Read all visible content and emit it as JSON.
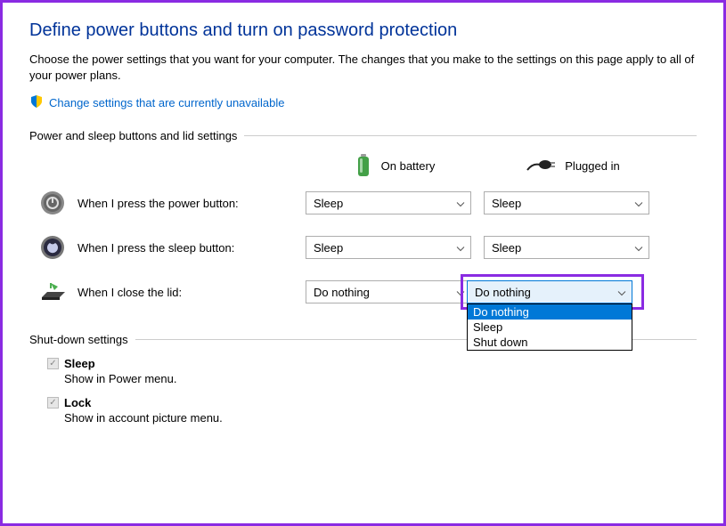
{
  "title": "Define power buttons and turn on password protection",
  "description": "Choose the power settings that you want for your computer. The changes that you make to the settings on this page apply to all of your power plans.",
  "change_link": "Change settings that are currently unavailable",
  "section1_header": "Power and sleep buttons and lid settings",
  "columns": {
    "battery": "On battery",
    "plugged": "Plugged in"
  },
  "rows": {
    "power": {
      "label": "When I press the power button:",
      "battery_value": "Sleep",
      "plugged_value": "Sleep"
    },
    "sleep": {
      "label": "When I press the sleep button:",
      "battery_value": "Sleep",
      "plugged_value": "Sleep"
    },
    "lid": {
      "label": "When I close the lid:",
      "battery_value": "Do nothing",
      "plugged_value": "Do nothing"
    }
  },
  "dropdown": {
    "options": [
      "Do nothing",
      "Sleep",
      "Shut down"
    ],
    "selected": "Do nothing"
  },
  "section2_header": "Shut-down settings",
  "shutdown_items": {
    "sleep": {
      "label": "Sleep",
      "desc": "Show in Power menu."
    },
    "lock": {
      "label": "Lock",
      "desc": "Show in account picture menu."
    }
  }
}
